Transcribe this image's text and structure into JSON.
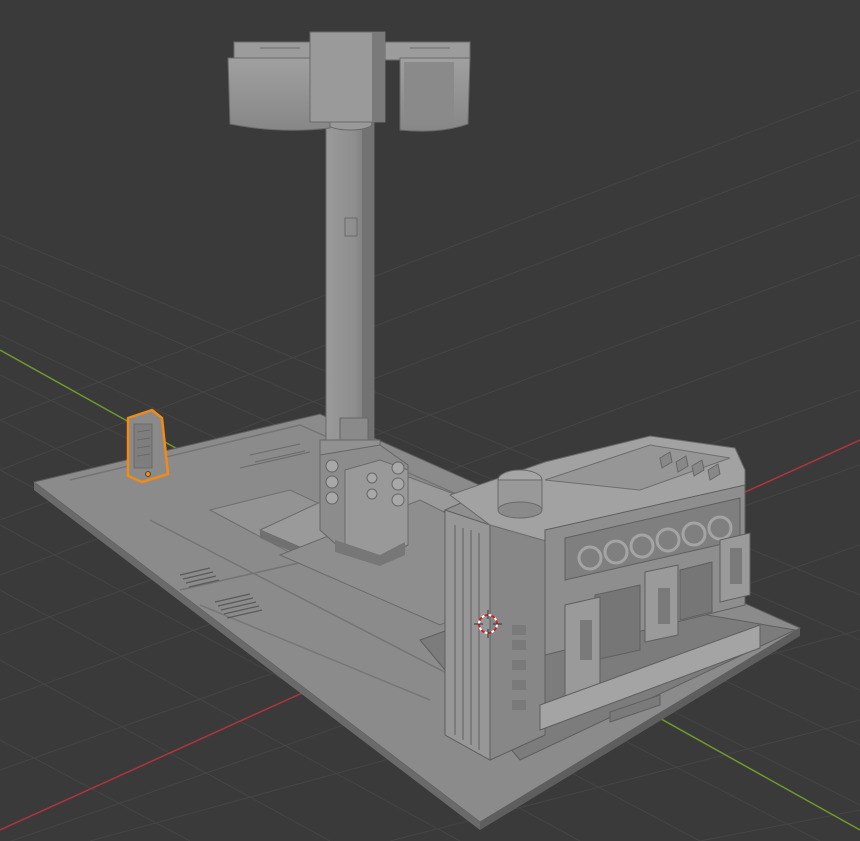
{
  "viewport": {
    "background": "#3a3a3a",
    "grid_color": "#444444",
    "x_axis_color": "#b0343f",
    "y_axis_color": "#6f9a2a",
    "selection_color": "#f28a16",
    "mesh_fill": "#8c8c8c",
    "mesh_dark": "#6b6b6b",
    "mesh_light": "#a7a7a7",
    "selected_object": "small-generator-prop",
    "cursor": "3d-cursor-icon",
    "model": "sci-fi-street-kiosk-diorama"
  }
}
